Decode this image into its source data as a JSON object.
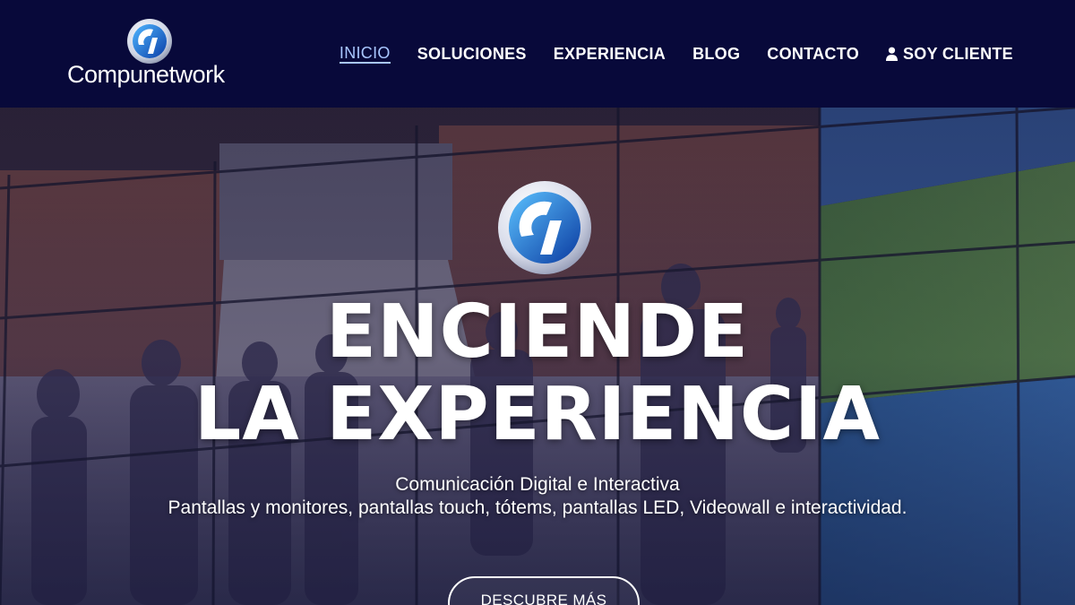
{
  "brand": {
    "name": "Compunetwork",
    "logo_icon": "compunetwork-logo-icon",
    "colors": {
      "header_bg": "#08093a",
      "active_link": "#a9c7ff",
      "text": "#ffffff"
    }
  },
  "nav": {
    "items": [
      {
        "label": "INICIO",
        "active": true
      },
      {
        "label": "SOLUCIONES",
        "active": false
      },
      {
        "label": "EXPERIENCIA",
        "active": false
      },
      {
        "label": "BLOG",
        "active": false
      },
      {
        "label": "CONTACTO",
        "active": false
      },
      {
        "label": "SOY CLIENTE",
        "active": false,
        "icon": "user-icon"
      }
    ]
  },
  "hero": {
    "background_description_icon": "videowall-photo",
    "emblem_icon": "compunetwork-emblem-icon",
    "title_line1": "ENCIENDE",
    "title_line2": "LA EXPERIENCIA",
    "subtitle_line1": "Comunicación Digital e Interactiva",
    "subtitle_line2": "Pantallas y monitores, pantallas touch, tótems, pantallas LED, Videowall e interactividad.",
    "cta_label": "DESCUBRE MÁS"
  }
}
